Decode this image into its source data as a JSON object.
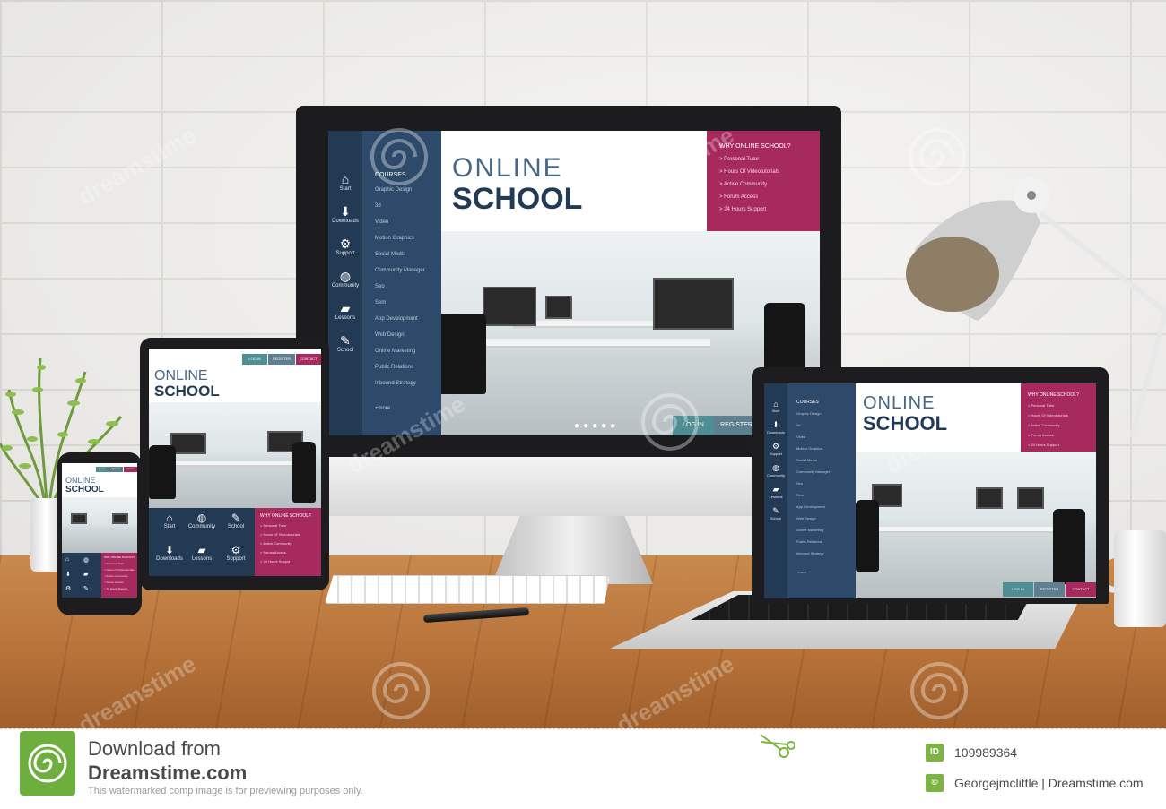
{
  "site": {
    "nav": [
      {
        "label": "Start",
        "icon": "home-icon",
        "glyph": "⌂"
      },
      {
        "label": "Downloads",
        "icon": "download-icon",
        "glyph": "⬇"
      },
      {
        "label": "Support",
        "icon": "gears-icon",
        "glyph": "⚙"
      },
      {
        "label": "Community",
        "icon": "globe-icon",
        "glyph": "◍"
      },
      {
        "label": "Lessons",
        "icon": "folder-icon",
        "glyph": "▰"
      },
      {
        "label": "School",
        "icon": "pencil-icon",
        "glyph": "✎"
      }
    ],
    "courses_heading": "COURSES",
    "courses": [
      "Graphic Design",
      "3d",
      "Video",
      "Motion Graphics",
      "Social Media",
      "Community Manager",
      "Seo",
      "Sem",
      "App Development",
      "Web Design",
      "Online Marketing",
      "Public Relations",
      "Inbound Strategy"
    ],
    "more_label": "+more",
    "title_line1": "ONLINE",
    "title_line2": "SCHOOL",
    "why_heading": "WHY ONLINE SCHOOL?",
    "why_items": [
      "> Personal Tutor",
      "> Hours Of Videotutorials",
      "> Active Community",
      "> Forum Access",
      "> 24 Hours Support"
    ],
    "login_label": "LOG IN",
    "register_label": "REGISTER",
    "contact_label": "CONTACT",
    "colors": {
      "navy": "#233a55",
      "menu": "#2d4a6b",
      "magenta": "#a72a5f",
      "teal": "#4f8f94"
    }
  },
  "watermark": {
    "text": "dreamstime"
  },
  "footer": {
    "download_line1": "Download from",
    "download_line2": "Dreamstime.com",
    "note": "This watermarked comp image is for previewing purposes only.",
    "id_badge": "ID",
    "image_id": "109989364",
    "author": "Georgejmclittle | Dreamstime.com"
  }
}
